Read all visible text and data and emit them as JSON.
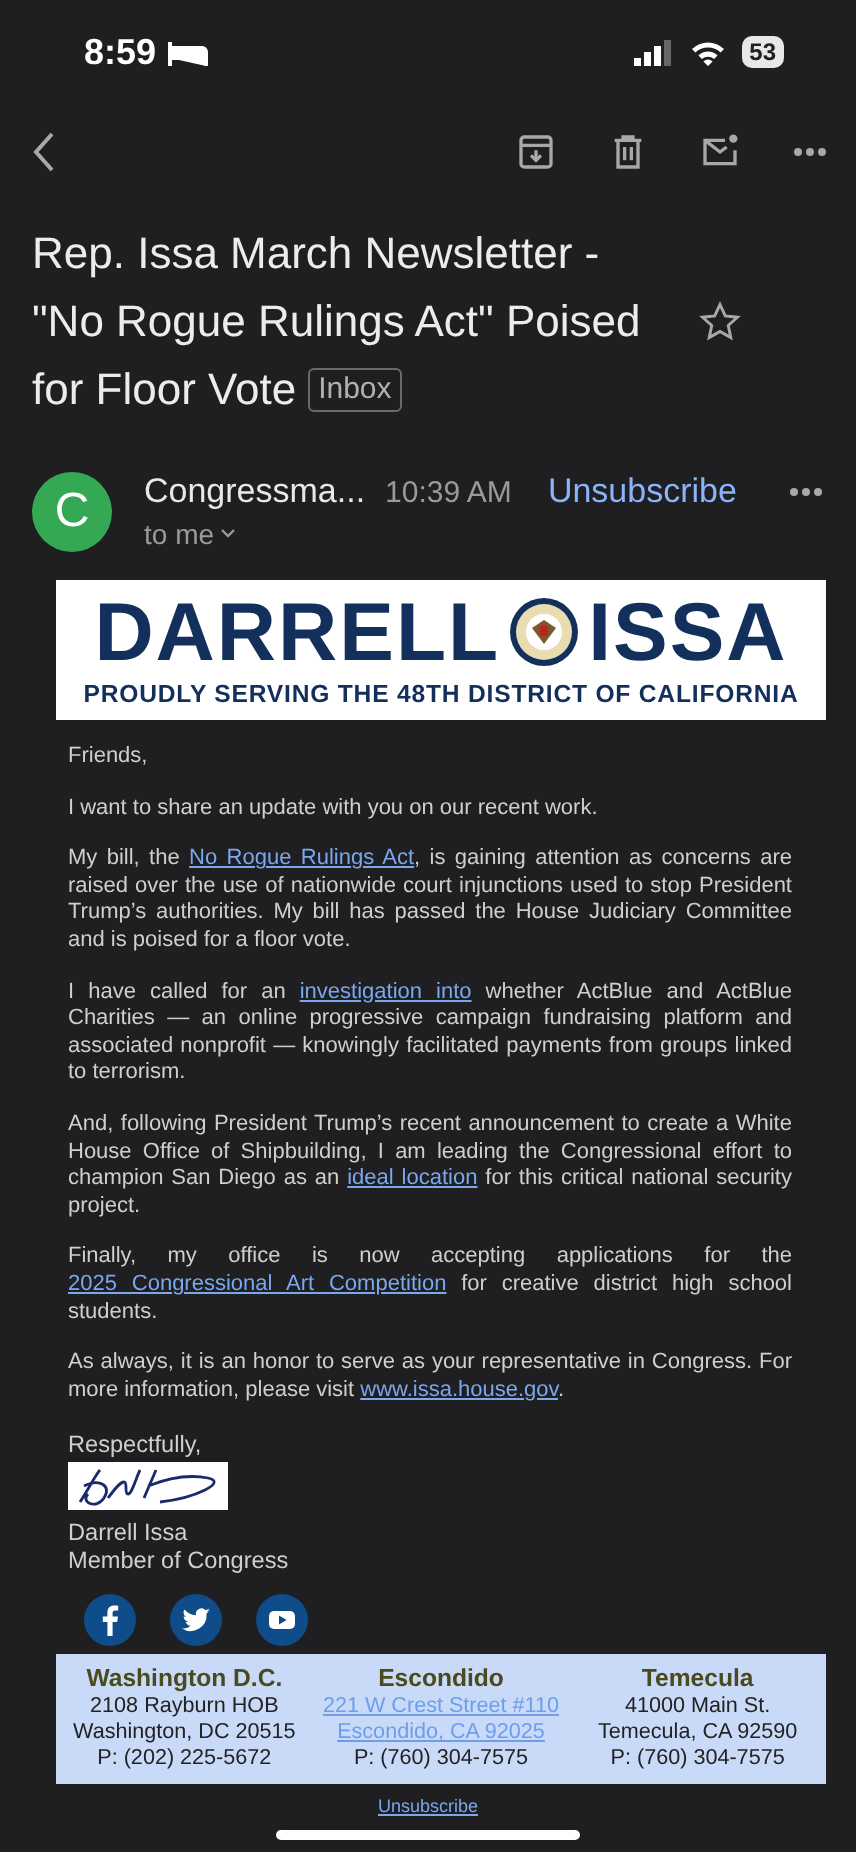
{
  "status_bar": {
    "time": "8:59",
    "battery": "53"
  },
  "subject": {
    "title": "Rep. Issa March Newsletter - \"No Rogue Rulings Act\" Poised for Floor Vote",
    "label": "Inbox",
    "starred": false
  },
  "sender": {
    "avatar_letter": "C",
    "name": "Congressma...",
    "time": "10:39 AM",
    "unsubscribe": "Unsubscribe",
    "recipient": "to me"
  },
  "banner": {
    "name_first": "DARRELL",
    "name_last": "ISSA",
    "tagline": "PROUDLY SERVING THE 48TH DISTRICT OF CALIFORNIA"
  },
  "paragraphs": [
    [
      {
        "kind": "text",
        "text": "Friends,"
      }
    ],
    [
      {
        "kind": "text",
        "text": "I want to share an update with you on our recent work."
      }
    ],
    [
      {
        "kind": "text",
        "text": "My bill, the "
      },
      {
        "kind": "link",
        "text": "No Rogue Rulings Act"
      },
      {
        "kind": "text",
        "text": ", is gaining attention as concerns are raised over the use of nationwide court injunctions used to stop President Trump’s authorities. My bill has passed the House Judiciary Committee and is poised for a floor vote."
      }
    ],
    [
      {
        "kind": "text",
        "text": "I have called for an "
      },
      {
        "kind": "link",
        "text": "investigation into"
      },
      {
        "kind": "text",
        "text": " whether ActBlue and ActBlue Charities — an online progressive campaign fundraising platform and associated nonprofit — knowingly facilitated payments from groups linked to terrorism."
      }
    ],
    [
      {
        "kind": "text",
        "text": "And, following President Trump’s recent announcement to create a White House Office of Shipbuilding, I am leading the Congressional effort to champion San Diego as an "
      },
      {
        "kind": "link",
        "text": "ideal location"
      },
      {
        "kind": "text",
        "text": " for this critical national security project."
      }
    ],
    [
      {
        "kind": "text",
        "text": "Finally, my office is now accepting applications for the "
      },
      {
        "kind": "link",
        "text": "2025 Congressional Art Competition"
      },
      {
        "kind": "text",
        "text": " for creative district high school students."
      }
    ],
    [
      {
        "kind": "text",
        "text": "As always, it is an honor to serve as your representative in Congress. For more information, please visit "
      },
      {
        "kind": "link",
        "text": "www.issa.house.gov"
      },
      {
        "kind": "text",
        "text": "."
      }
    ]
  ],
  "signature": {
    "closing": "Respectfully,",
    "name": "Darrell Issa",
    "title": "Member of Congress"
  },
  "social": [
    {
      "kind": "facebook"
    },
    {
      "kind": "twitter"
    },
    {
      "kind": "youtube"
    }
  ],
  "offices": [
    {
      "name": "Washington D.C.",
      "lines": [
        {
          "kind": "text",
          "text": "2108 Rayburn HOB"
        },
        {
          "kind": "text",
          "text": "Washington, DC 20515"
        },
        {
          "kind": "text",
          "text": "P: (202) 225-5672"
        }
      ]
    },
    {
      "name": "Escondido",
      "lines": [
        {
          "kind": "link",
          "text": "221 W Crest Street #110"
        },
        {
          "kind": "link",
          "text": "Escondido, CA 92025"
        },
        {
          "kind": "text",
          "text": "P: (760) 304-7575"
        }
      ]
    },
    {
      "name": "Temecula",
      "lines": [
        {
          "kind": "text",
          "text": "41000 Main St."
        },
        {
          "kind": "text",
          "text": "Temecula, CA 92590"
        },
        {
          "kind": "text",
          "text": "P: (760) 304-7575"
        }
      ]
    }
  ],
  "footer_link": "Unsubscribe"
}
